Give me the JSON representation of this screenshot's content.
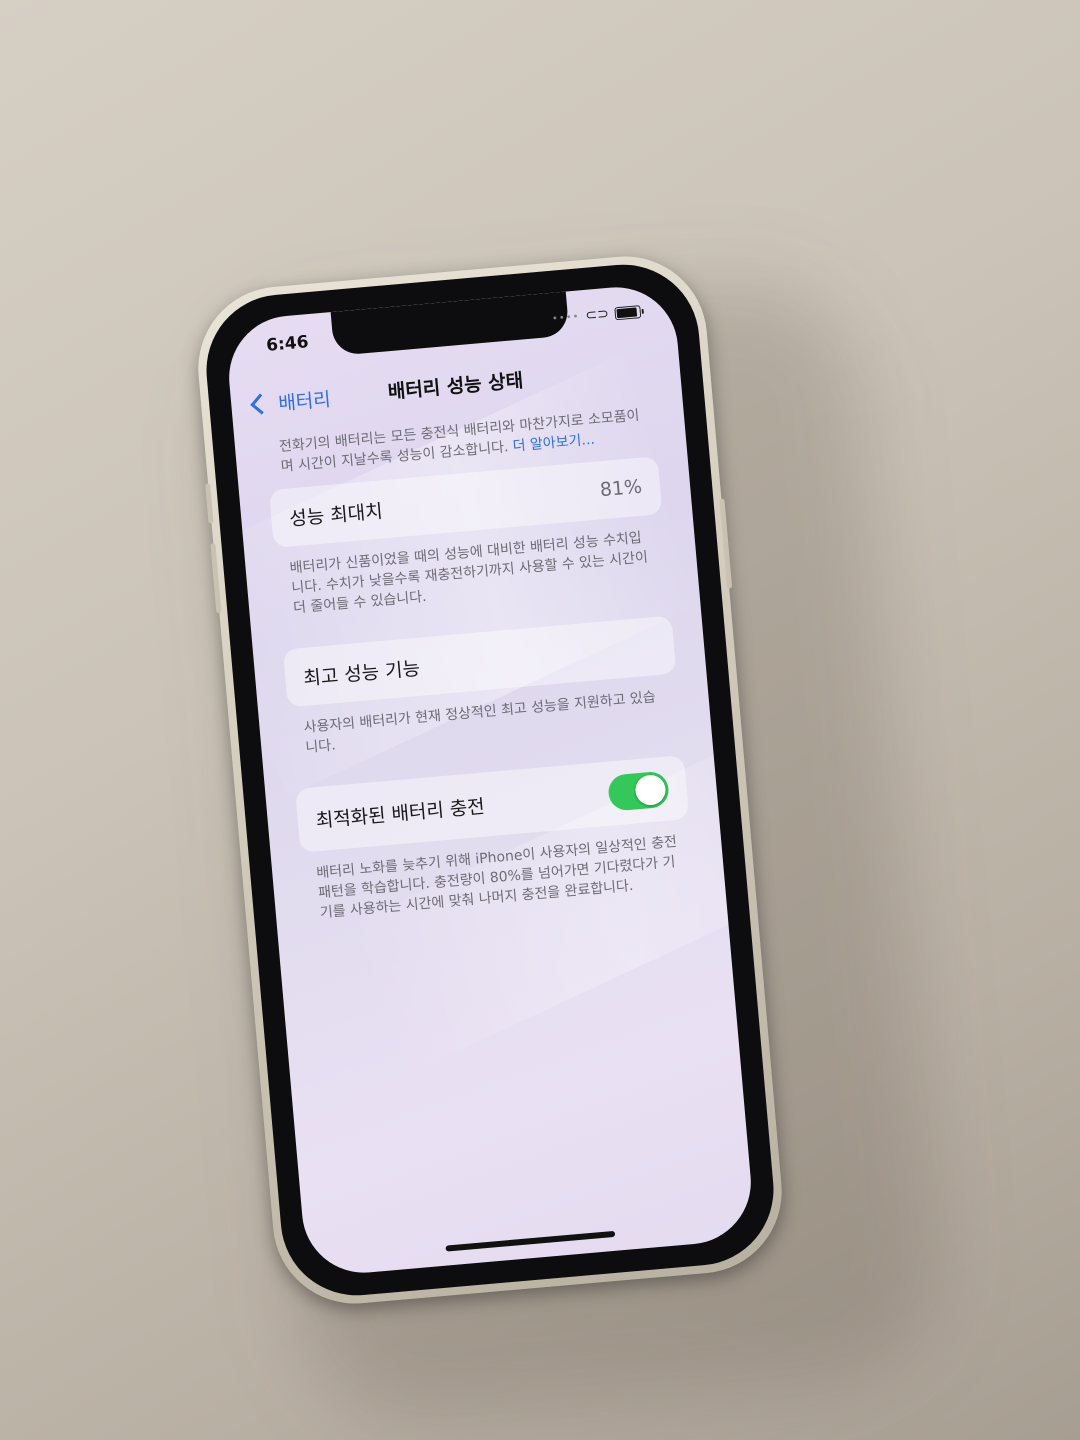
{
  "status_bar": {
    "time": "6:46"
  },
  "nav": {
    "back_label": "배터리",
    "title": "배터리 성능 상태"
  },
  "intro": {
    "text": "전화기의 배터리는 모든 충전식 배터리와 마찬가지로 소모품이며 시간이 지날수록 성능이 감소합니다. ",
    "link": "더 알아보기..."
  },
  "maximum_capacity": {
    "value": "81%",
    "label": "성능 최대치",
    "description": "배터리가 신품이었을 때의 성능에 대비한 배터리 성능 수치입니다. 수치가 낮을수록 재충전하기까지 사용할 수 있는 시간이 더 줄어들 수 있습니다."
  },
  "peak_performance": {
    "label": "최고 성능 기능",
    "description": "사용자의 배터리가 현재 정상적인 최고 성능을 지원하고 있습니다."
  },
  "optimized_charging": {
    "label": "최적화된 배터리 충전",
    "enabled": true,
    "description": "배터리 노화를 늦추기 위해 iPhone이 사용자의 일상적인 충전 패턴을 학습합니다. 충전량이 80%를 넘어가면 기다렸다가 기기를 사용하는 시간에 맞춰 나머지 충전을 완료합니다."
  },
  "colors": {
    "accent": "#2f6fe0",
    "toggle_on": "#34c759"
  }
}
